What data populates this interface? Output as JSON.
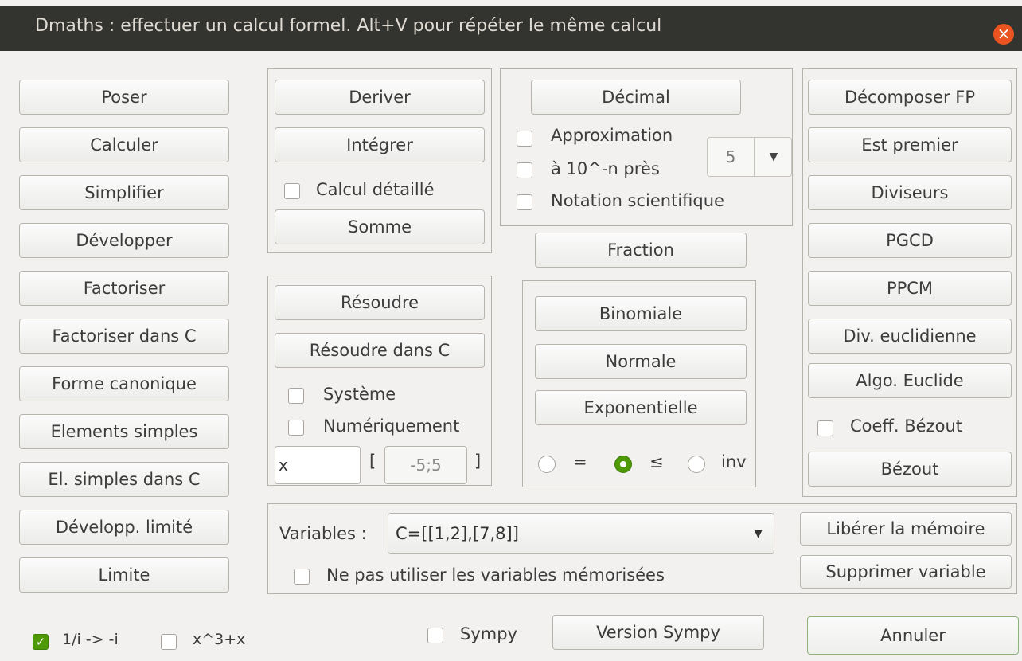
{
  "window": {
    "title": "Dmaths : effectuer un calcul formel. Alt+V  pour répéter le même calcul",
    "close_glyph": "×"
  },
  "left_buttons": [
    "Poser",
    "Calculer",
    "Simplifier",
    "Développer",
    "Factoriser",
    "Factoriser dans C",
    "Forme canonique",
    "Elements simples",
    "El. simples dans C",
    "Développ. limité",
    "Limite"
  ],
  "calculus": {
    "deriver": "Deriver",
    "integrer": "Intégrer",
    "calcul_detaille": "Calcul détaillé",
    "somme": "Somme"
  },
  "solve": {
    "resoudre": "Résoudre",
    "resoudre_c": "Résoudre dans C",
    "systeme": "Système",
    "numeriquement": "Numériquement",
    "var_value": "x",
    "bracket_open": "[",
    "interval_value": "-5;5",
    "bracket_close": "]"
  },
  "decimal": {
    "decimal_button": "Décimal",
    "approximation": "Approximation",
    "precision": "à 10^-n près",
    "notation": "Notation scientifique",
    "digits": "5"
  },
  "fraction_button": "Fraction",
  "distribution": {
    "binomiale": "Binomiale",
    "normale": "Normale",
    "exponentielle": "Exponentielle",
    "eq_symbol": "=",
    "le_symbol": "≤",
    "inv_label": "inv"
  },
  "arith_buttons": [
    "Décomposer FP",
    "Est premier",
    "Diviseurs",
    "PGCD",
    "PPCM",
    "Div. euclidienne",
    "Algo. Euclide"
  ],
  "arith": {
    "coeff_bezout": "Coeff. Bézout",
    "bezout_button": "Bézout"
  },
  "variables": {
    "label": "Variables :",
    "selected": "C=[[1,2],[7,8]]",
    "no_memory": "Ne pas utiliser les variables mémorisées",
    "free_memory": "Libérer la mémoire",
    "delete_variable": "Supprimer variable"
  },
  "bottom": {
    "one_over_i": "1/i -> -i",
    "x3": "x^3+x",
    "sympy": "Sympy",
    "version_sympy": "Version Sympy",
    "annuler": "Annuler"
  }
}
